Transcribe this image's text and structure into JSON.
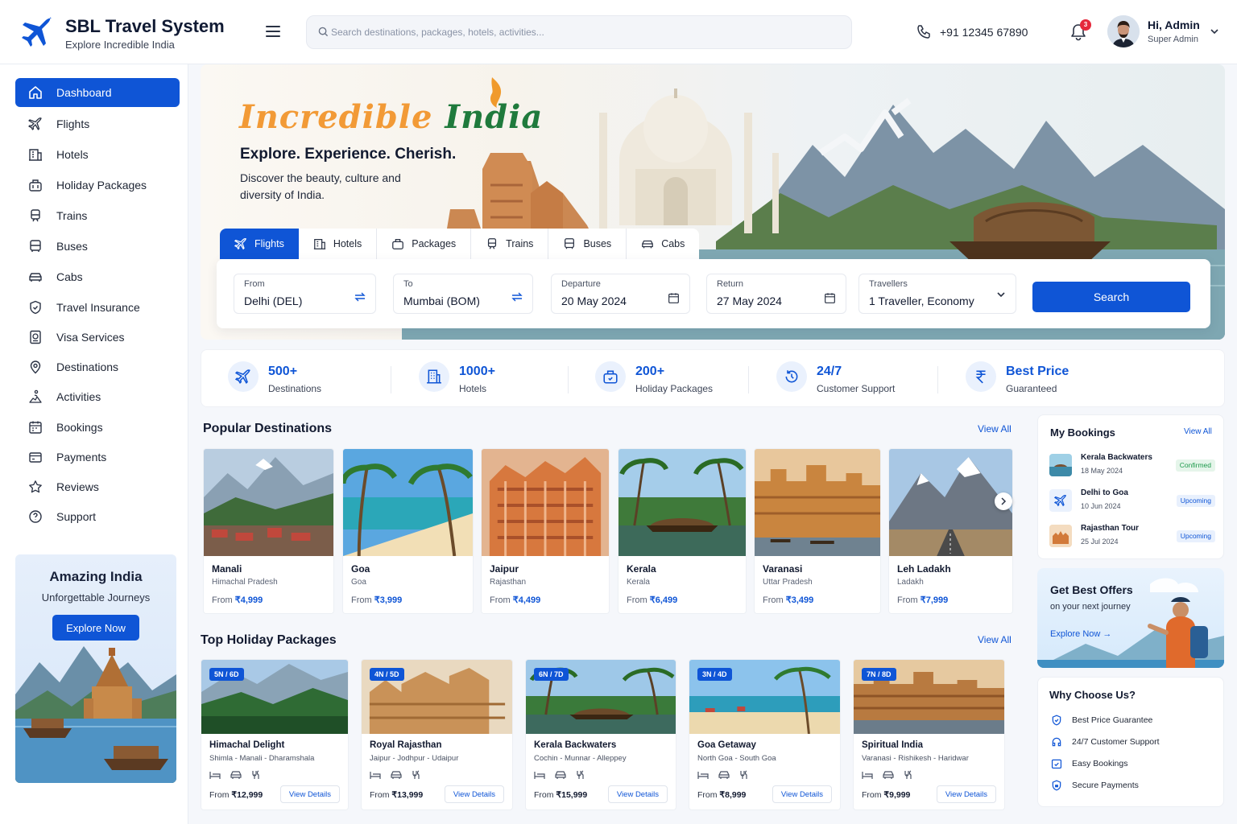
{
  "brand": {
    "title": "SBL Travel System",
    "subtitle": "Explore Incredible India"
  },
  "header": {
    "search_placeholder": "Search destinations, packages, hotels, activities...",
    "phone": "+91 12345 67890",
    "notifications": "3",
    "user_name": "Hi, Admin",
    "user_role": "Super Admin"
  },
  "sidebar": {
    "items": [
      {
        "label": "Dashboard",
        "icon": "home-icon"
      },
      {
        "label": "Flights",
        "icon": "plane-icon"
      },
      {
        "label": "Hotels",
        "icon": "hotel-icon"
      },
      {
        "label": "Holiday Packages",
        "icon": "luggage-icon"
      },
      {
        "label": "Trains",
        "icon": "train-icon"
      },
      {
        "label": "Buses",
        "icon": "bus-icon"
      },
      {
        "label": "Cabs",
        "icon": "car-icon"
      },
      {
        "label": "Travel Insurance",
        "icon": "shield-icon"
      },
      {
        "label": "Visa Services",
        "icon": "passport-icon"
      },
      {
        "label": "Destinations",
        "icon": "map-pin-icon"
      },
      {
        "label": "Activities",
        "icon": "hiking-icon"
      },
      {
        "label": "Bookings",
        "icon": "calendar-icon"
      },
      {
        "label": "Payments",
        "icon": "wallet-icon"
      },
      {
        "label": "Reviews",
        "icon": "star-icon"
      },
      {
        "label": "Support",
        "icon": "help-icon"
      }
    ],
    "promo": {
      "title": "Amazing India",
      "subtitle": "Unforgettable Journeys",
      "button": "Explore Now"
    }
  },
  "hero": {
    "title_part1": "Incredible",
    "title_part2": "India",
    "tagline": "Explore. Experience. Cherish.",
    "description": "Discover the beauty, culture and diversity of India."
  },
  "booking_tabs": [
    "Flights",
    "Hotels",
    "Packages",
    "Trains",
    "Buses",
    "Cabs"
  ],
  "search_form": {
    "from": {
      "label": "From",
      "value": "Delhi (DEL)"
    },
    "to": {
      "label": "To",
      "value": "Mumbai (BOM)"
    },
    "departure": {
      "label": "Departure",
      "value": "20 May 2024"
    },
    "return": {
      "label": "Return",
      "value": "27 May 2024"
    },
    "travellers": {
      "label": "Travellers",
      "value": "1 Traveller, Economy"
    },
    "button": "Search"
  },
  "stats": [
    {
      "value": "500+",
      "label": "Destinations",
      "icon": "plane-route-icon"
    },
    {
      "value": "1000+",
      "label": "Hotels",
      "icon": "building-icon"
    },
    {
      "value": "200+",
      "label": "Holiday Packages",
      "icon": "luggage-icon"
    },
    {
      "value": "24/7",
      "label": "Customer Support",
      "icon": "clock-support-icon"
    },
    {
      "value": "Best Price",
      "label": "Guaranteed",
      "icon": "rupee-icon"
    }
  ],
  "popular": {
    "title": "Popular Destinations",
    "view_all": "View All",
    "items": [
      {
        "name": "Manali",
        "state": "Himachal Pradesh",
        "from": "From",
        "price": "₹4,999"
      },
      {
        "name": "Goa",
        "state": "Goa",
        "from": "From",
        "price": "₹3,999"
      },
      {
        "name": "Jaipur",
        "state": "Rajasthan",
        "from": "From",
        "price": "₹4,499"
      },
      {
        "name": "Kerala",
        "state": "Kerala",
        "from": "From",
        "price": "₹6,499"
      },
      {
        "name": "Varanasi",
        "state": "Uttar Pradesh",
        "from": "From",
        "price": "₹3,499"
      },
      {
        "name": "Leh Ladakh",
        "state": "Ladakh",
        "from": "From",
        "price": "₹7,999"
      }
    ]
  },
  "packages": {
    "title": "Top Holiday Packages",
    "view_all": "View All",
    "details": "View Details",
    "items": [
      {
        "duration": "5N / 6D",
        "name": "Himachal Delight",
        "route": "Shimla - Manali - Dharamshala",
        "from": "From",
        "price": "₹12,999"
      },
      {
        "duration": "4N / 5D",
        "name": "Royal Rajasthan",
        "route": "Jaipur - Jodhpur - Udaipur",
        "from": "From",
        "price": "₹13,999"
      },
      {
        "duration": "6N / 7D",
        "name": "Kerala Backwaters",
        "route": "Cochin - Munnar - Alleppey",
        "from": "From",
        "price": "₹15,999"
      },
      {
        "duration": "3N / 4D",
        "name": "Goa Getaway",
        "route": "North Goa - South Goa",
        "from": "From",
        "price": "₹8,999"
      },
      {
        "duration": "7N / 8D",
        "name": "Spiritual India",
        "route": "Varanasi - Rishikesh - Haridwar",
        "from": "From",
        "price": "₹9,999"
      }
    ]
  },
  "my_bookings": {
    "title": "My Bookings",
    "view_all": "View All",
    "items": [
      {
        "title": "Kerala Backwaters",
        "date": "18 May 2024",
        "status": "Confirmed",
        "status_color": "#1e9a4c"
      },
      {
        "title": "Delhi to Goa",
        "date": "10 Jun 2024",
        "status": "Upcoming",
        "status_color": "#0f55d6"
      },
      {
        "title": "Rajasthan Tour",
        "date": "25 Jul 2024",
        "status": "Upcoming",
        "status_color": "#0f55d6"
      }
    ]
  },
  "offers": {
    "title": "Get Best Offers",
    "subtitle": "on your next journey",
    "link": "Explore Now →"
  },
  "why": {
    "title": "Why Choose Us?",
    "items": [
      {
        "label": "Best Price Guarantee",
        "icon": "shield-check-icon"
      },
      {
        "label": "24/7 Customer Support",
        "icon": "headset-icon"
      },
      {
        "label": "Easy Bookings",
        "icon": "calendar-check-icon"
      },
      {
        "label": "Secure Payments",
        "icon": "lock-shield-icon"
      }
    ]
  },
  "colors": {
    "primary": "#0f55d6",
    "hero_orange": "#f29a36",
    "hero_green": "#1f7a3c",
    "confirmed": "#1e9a4c"
  }
}
